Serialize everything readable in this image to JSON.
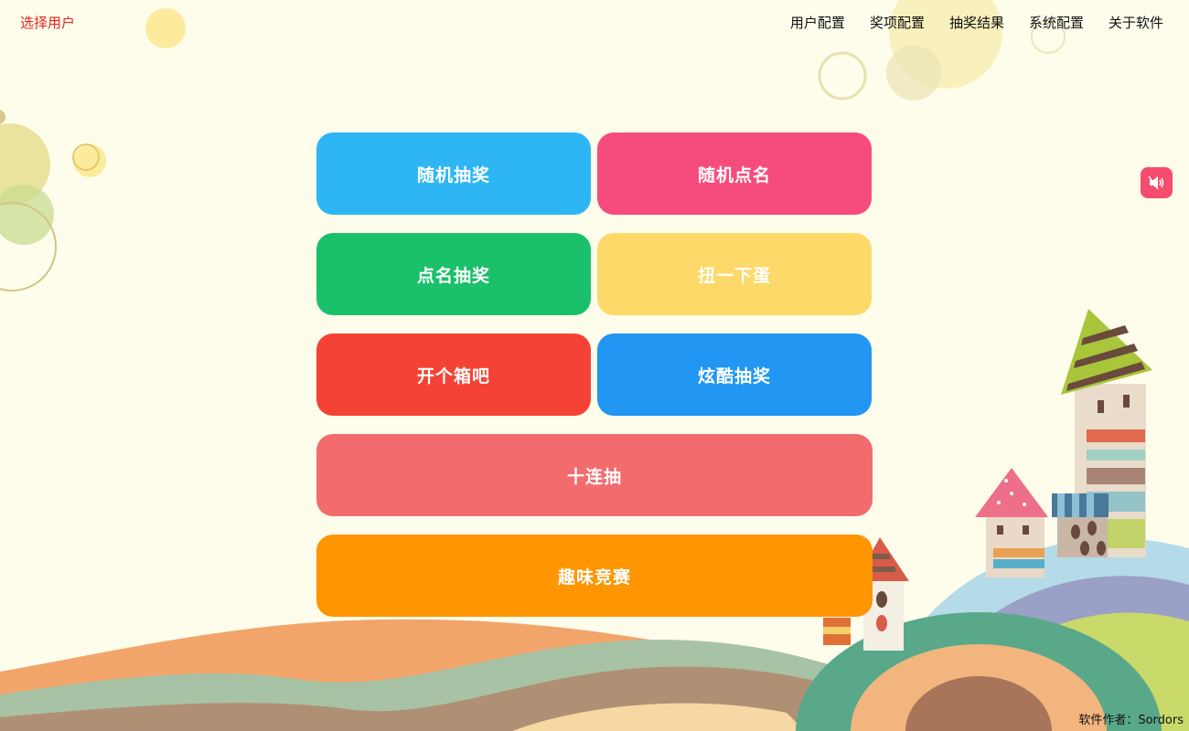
{
  "header": {
    "select_user": "选择用户",
    "nav": [
      "用户配置",
      "奖项配置",
      "抽奖结果",
      "系统配置",
      "关于软件"
    ]
  },
  "buttons": [
    {
      "label": "随机抽奖",
      "color": "#2eb6f4"
    },
    {
      "label": "随机点名",
      "color": "#f64c7b"
    },
    {
      "label": "点名抽奖",
      "color": "#1bc06a"
    },
    {
      "label": "扭一下蛋",
      "color": "#fcd969"
    },
    {
      "label": "开个箱吧",
      "color": "#f44336"
    },
    {
      "label": "炫酷抽奖",
      "color": "#2196f3"
    },
    {
      "label": "十连抽",
      "color": "#f26c6e"
    },
    {
      "label": "趣味竞赛",
      "color": "#ff9500"
    }
  ],
  "sound_toggle": {
    "icon": "speaker-icon",
    "color": "#f64c6e"
  },
  "footer": {
    "author": "软件作者：Sordors"
  }
}
